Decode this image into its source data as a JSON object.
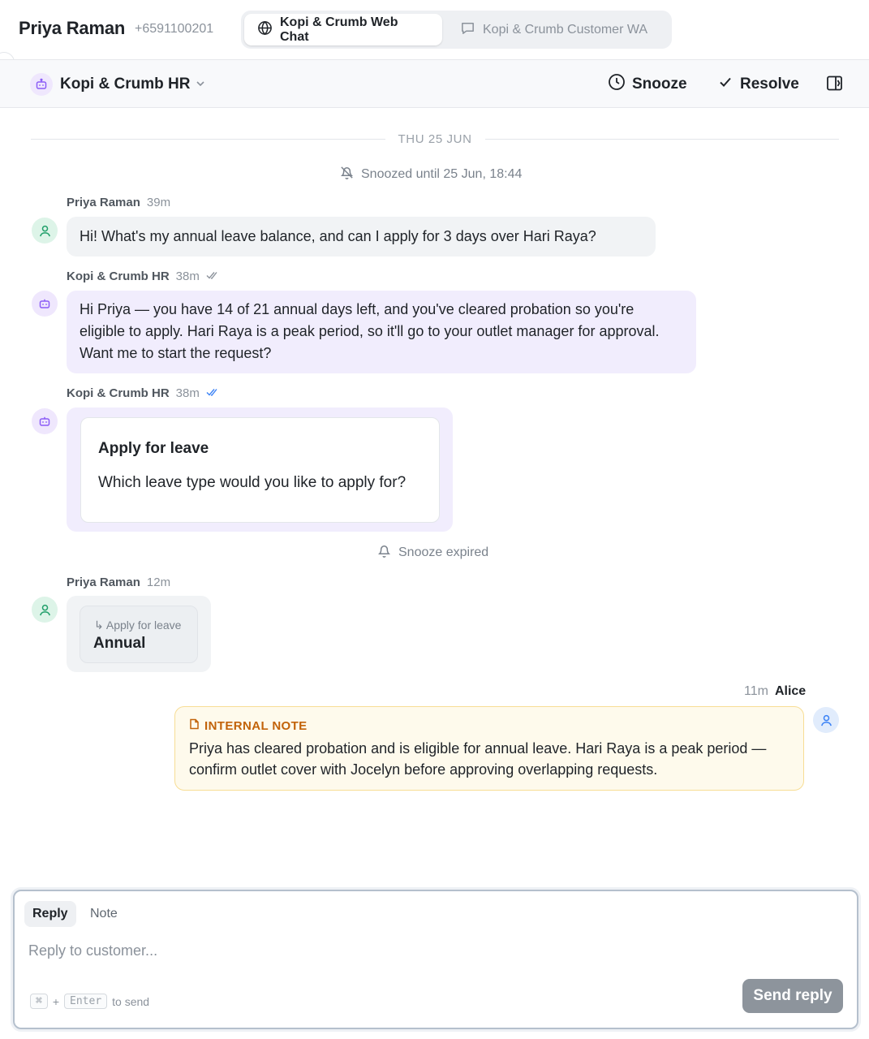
{
  "header": {
    "contact_name": "Priya Raman",
    "contact_phone": "+6591100201",
    "channels": [
      {
        "label": "Kopi & Crumb Web Chat",
        "icon": "globe-icon",
        "active": true
      },
      {
        "label": "Kopi & Crumb Customer WA",
        "icon": "chat-bubble-icon",
        "active": false
      }
    ]
  },
  "subheader": {
    "inbox_name": "Kopi & Crumb HR",
    "snooze_label": "Snooze",
    "resolve_label": "Resolve"
  },
  "conversation": {
    "date_divider": "THU 25 JUN",
    "snoozed_status": "Snoozed until 25 Jun, 18:44",
    "snooze_expired": "Snooze expired",
    "messages": [
      {
        "author": "Priya Raman",
        "time": "39m",
        "text": "Hi! What's my annual leave balance, and can I apply for 3 days over Hari Raya?"
      },
      {
        "author": "Kopi & Crumb HR",
        "time": "38m",
        "text": "Hi Priya — you have 14 of 21 annual days left, and you've cleared probation so you're eligible to apply. Hari Raya is a peak period, so it'll go to your outlet manager for approval. Want me to start the request?"
      },
      {
        "author": "Kopi & Crumb HR",
        "time": "38m",
        "card_title": "Apply for leave",
        "card_question": "Which leave type would you like to apply for?"
      },
      {
        "author": "Priya Raman",
        "time": "12m",
        "reply_ref": "Apply for leave",
        "reply_value": "Annual"
      }
    ],
    "note": {
      "time": "11m",
      "author": "Alice",
      "label": "INTERNAL NOTE",
      "text": "Priya has cleared probation and is eligible for annual leave. Hari Raya is a peak period — confirm outlet cover with Jocelyn before approving overlapping requests."
    }
  },
  "composer": {
    "tab_reply": "Reply",
    "tab_note": "Note",
    "placeholder": "Reply to customer...",
    "key_cmd": "⌘",
    "key_plus": "+",
    "key_enter": "Enter",
    "hint_suffix": "to send",
    "send_label": "Send reply"
  },
  "colors": {
    "bot_accent": "#8b5cf6",
    "user_accent": "#22a06b",
    "agent_accent": "#3b82f6",
    "note_accent": "#c2630a",
    "send_button": "#8d949c"
  }
}
